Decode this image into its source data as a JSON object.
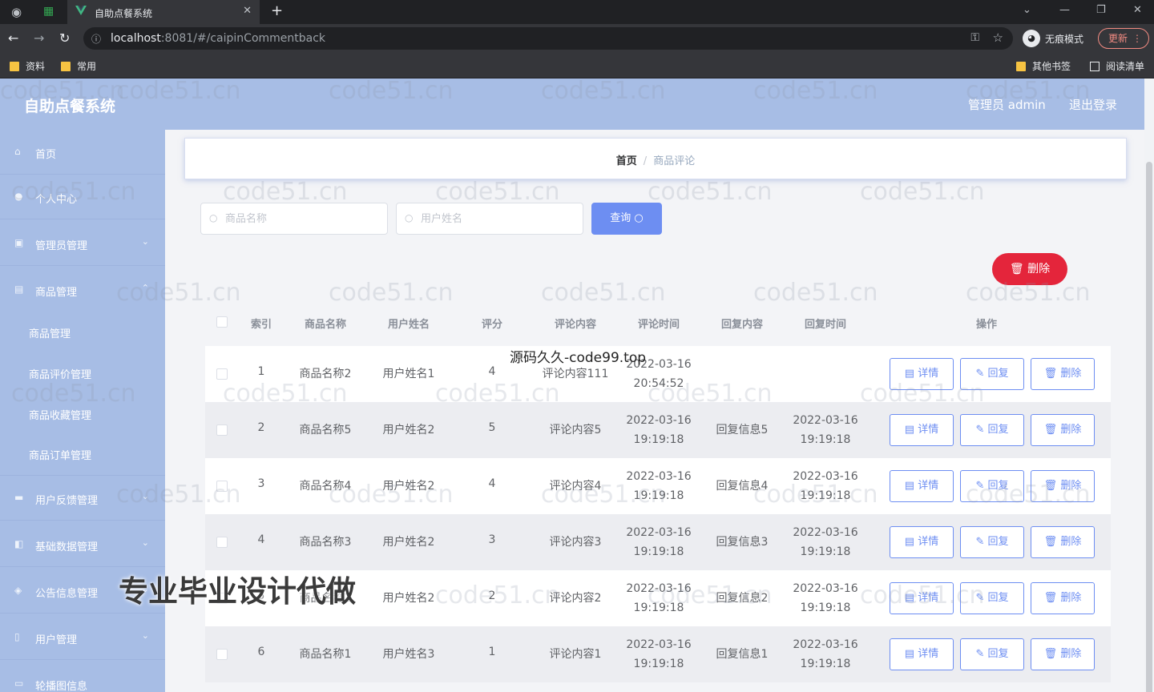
{
  "browser": {
    "tab_title": "自助点餐系统",
    "url_host": "localhost",
    "url_rest": ":8081/#/caipinCommentback",
    "incognito_label": "无痕模式",
    "update_label": "更新",
    "bookmarks": [
      "资料",
      "常用"
    ],
    "bookmarks_right": [
      "其他书签",
      "阅读清单"
    ]
  },
  "header": {
    "title": "自助点餐系统",
    "admin": "管理员 admin",
    "logout": "退出登录"
  },
  "sidebar": {
    "home": "首页",
    "profile": "个人中心",
    "admin_mgmt": "管理员管理",
    "goods_mgmt": "商品管理",
    "goods_sub": [
      "商品管理",
      "商品评价管理",
      "商品收藏管理",
      "商品订单管理"
    ],
    "feedback": "用户反馈管理",
    "basic": "基础数据管理",
    "notice": "公告信息管理",
    "user": "用户管理",
    "carousel": "轮播图信息"
  },
  "breadcrumb": {
    "home": "首页",
    "sep": "/",
    "current": "商品评论"
  },
  "search": {
    "goods_placeholder": "商品名称",
    "user_placeholder": "用户姓名",
    "query_label": "查询"
  },
  "toolbar": {
    "delete_label": "删除"
  },
  "table": {
    "headers": {
      "index": "索引",
      "goods": "商品名称",
      "user": "用户姓名",
      "score": "评分",
      "content": "评论内容",
      "time": "评论时间",
      "reply": "回复内容",
      "reply_time": "回复时间",
      "ops": "操作"
    },
    "ops": {
      "detail": "详情",
      "reply": "回复",
      "delete": "删除"
    },
    "rows": [
      {
        "index": "1",
        "goods": "商品名称2",
        "user": "用户姓名1",
        "score": "4",
        "content": "评论内容111",
        "time_d": "2022-03-16",
        "time_t": "20:54:52",
        "reply": "",
        "reply_d": "",
        "reply_t": ""
      },
      {
        "index": "2",
        "goods": "商品名称5",
        "user": "用户姓名2",
        "score": "5",
        "content": "评论内容5",
        "time_d": "2022-03-16",
        "time_t": "19:19:18",
        "reply": "回复信息5",
        "reply_d": "2022-03-16",
        "reply_t": "19:19:18"
      },
      {
        "index": "3",
        "goods": "商品名称4",
        "user": "用户姓名2",
        "score": "4",
        "content": "评论内容4",
        "time_d": "2022-03-16",
        "time_t": "19:19:18",
        "reply": "回复信息4",
        "reply_d": "2022-03-16",
        "reply_t": "19:19:18"
      },
      {
        "index": "4",
        "goods": "商品名称3",
        "user": "用户姓名2",
        "score": "3",
        "content": "评论内容3",
        "time_d": "2022-03-16",
        "time_t": "19:19:18",
        "reply": "回复信息3",
        "reply_d": "2022-03-16",
        "reply_t": "19:19:18"
      },
      {
        "index": "5",
        "goods": "商品名称2",
        "user": "用户姓名2",
        "score": "2",
        "content": "评论内容2",
        "time_d": "2022-03-16",
        "time_t": "19:19:18",
        "reply": "回复信息2",
        "reply_d": "2022-03-16",
        "reply_t": "19:19:18"
      },
      {
        "index": "6",
        "goods": "商品名称1",
        "user": "用户姓名3",
        "score": "1",
        "content": "评论内容1",
        "time_d": "2022-03-16",
        "time_t": "19:19:18",
        "reply": "回复信息1",
        "reply_d": "2022-03-16",
        "reply_t": "19:19:18"
      }
    ]
  },
  "watermark": {
    "site": "code51.cn",
    "overlay": "源码久久-code99.top",
    "big": "专业毕业设计代做"
  }
}
